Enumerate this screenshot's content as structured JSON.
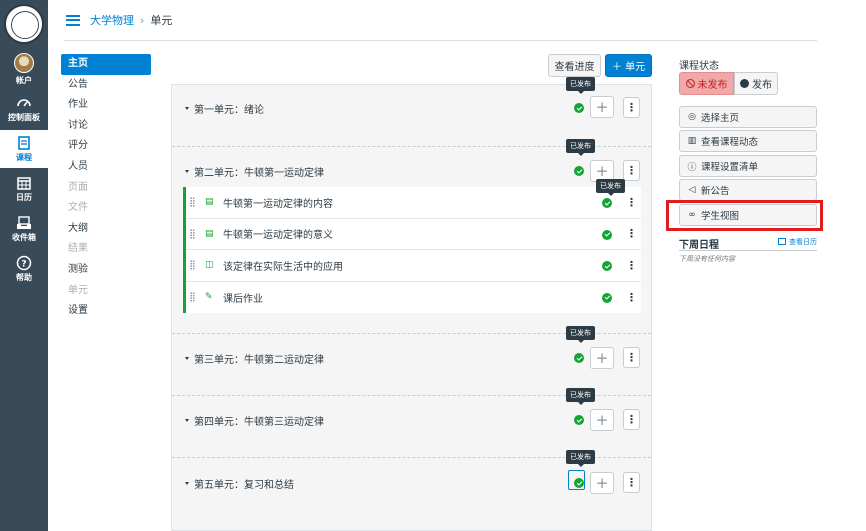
{
  "global_nav": {
    "items": [
      {
        "label": "帐户",
        "icon": "user-avatar"
      },
      {
        "label": "控制面板",
        "icon": "dashboard-icon"
      },
      {
        "label": "课程",
        "icon": "book-icon",
        "active": true
      },
      {
        "label": "日历",
        "icon": "calendar-icon"
      },
      {
        "label": "收件箱",
        "icon": "inbox-icon"
      },
      {
        "label": "帮助",
        "icon": "help-icon"
      }
    ]
  },
  "breadcrumb": {
    "course": "大学物理",
    "separator": "›",
    "current": "单元"
  },
  "course_nav": {
    "items": [
      {
        "label": "主页",
        "active": true
      },
      {
        "label": "公告"
      },
      {
        "label": "作业"
      },
      {
        "label": "讨论"
      },
      {
        "label": "评分"
      },
      {
        "label": "人员"
      },
      {
        "label": "页面",
        "disabled": true
      },
      {
        "label": "文件",
        "disabled": true
      },
      {
        "label": "大纲"
      },
      {
        "label": "结果",
        "disabled": true
      },
      {
        "label": "测验"
      },
      {
        "label": "单元",
        "disabled": true
      },
      {
        "label": "设置"
      }
    ]
  },
  "toolbar": {
    "progress_label": "查看进度",
    "add_module_label": "＋ 单元"
  },
  "modules": [
    {
      "title": "第一单元：绪论",
      "tooltip": "已发布"
    },
    {
      "title": "第二单元：牛顿第一运动定律",
      "tooltip": "已发布",
      "items": [
        {
          "title": "牛顿第一运动定律的内容",
          "icon": "page-icon",
          "tooltip": "已发布"
        },
        {
          "title": "牛顿第一运动定律的意义",
          "icon": "page-icon"
        },
        {
          "title": "该定律在实际生活中的应用",
          "icon": "discussion-icon"
        },
        {
          "title": "课后作业",
          "icon": "assignment-icon"
        }
      ]
    },
    {
      "title": "第三单元：牛顿第二运动定律",
      "tooltip": "已发布"
    },
    {
      "title": "第四单元：牛顿第三运动定律",
      "tooltip": "已发布"
    },
    {
      "title": "第五单元：复习和总结",
      "tooltip": "已发布"
    }
  ],
  "sidebar": {
    "status_title": "课程状态",
    "unpublish_label": "未发布",
    "publish_label": "发布",
    "buttons": [
      {
        "label": "选择主页",
        "icon": "target-icon"
      },
      {
        "label": "查看课程动态",
        "icon": "chart-icon"
      },
      {
        "label": "课程设置清单",
        "icon": "question-icon"
      },
      {
        "label": "新公告",
        "icon": "megaphone-icon"
      },
      {
        "label": "学生视图",
        "icon": "glasses-icon"
      }
    ],
    "upcoming_title": "下周日程",
    "calendar_link": "查看日历",
    "upcoming_empty": "下周没有任何内容"
  },
  "colors": {
    "nav_bg": "#394b58",
    "accent": "#0081d3",
    "published": "#16a335",
    "highlight": "#e21c1c"
  }
}
